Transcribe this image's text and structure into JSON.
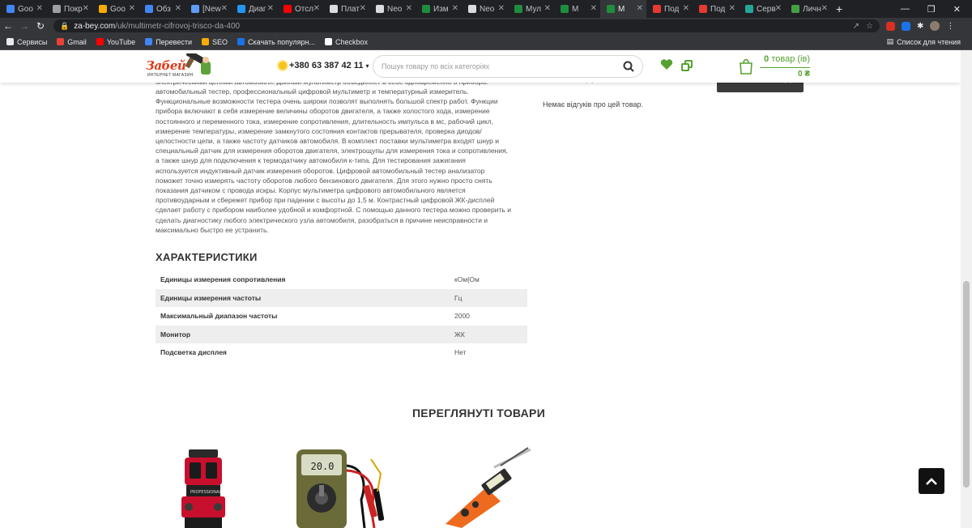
{
  "browser": {
    "tabs": [
      {
        "label": "Goo",
        "color": "#4285f4"
      },
      {
        "label": "Покр",
        "color": "#9aa0a6"
      },
      {
        "label": "Goo",
        "color": "#f9ab00"
      },
      {
        "label": "Обз",
        "color": "#4285f4"
      },
      {
        "label": "[New",
        "color": "#5f9cf5"
      },
      {
        "label": "Диаг",
        "color": "#2196f3"
      },
      {
        "label": "Отсл",
        "color": "#ff0000"
      },
      {
        "label": "Плат",
        "color": "#dadce0"
      },
      {
        "label": "Neo",
        "color": "#dadce0"
      },
      {
        "label": "Изм",
        "color": "#1e8e3e"
      },
      {
        "label": "Neo",
        "color": "#dadce0"
      },
      {
        "label": "Мул",
        "color": "#1e8e3e"
      },
      {
        "label": "М",
        "color": "#1e8e3e"
      },
      {
        "label": "М",
        "color": "#1e8e3e"
      },
      {
        "label": "Под",
        "color": "#e53935"
      },
      {
        "label": "Под",
        "color": "#e53935"
      },
      {
        "label": "Серв",
        "color": "#26a69a"
      },
      {
        "label": "Личн",
        "color": "#43a047"
      }
    ],
    "active_tab_index": 13,
    "new_tab": "+",
    "url_domain": "za-bey.com",
    "url_path": "/uk/multimetr-cifrovoj-trisco-da-400",
    "bookmarks": [
      {
        "label": "Сервисы",
        "color": "#e8eaed"
      },
      {
        "label": "Gmail",
        "color": "#ea4335"
      },
      {
        "label": "YouTube",
        "color": "#ff0000"
      },
      {
        "label": "Перевести",
        "color": "#4285f4"
      },
      {
        "label": "SEO",
        "color": "#f9ab00"
      },
      {
        "label": "Скачать популярн...",
        "color": "#1a73e8"
      },
      {
        "label": "Checkbox",
        "color": "#ffffff"
      }
    ],
    "reading_list": "Список для чтения"
  },
  "header": {
    "logo_text": "Забей",
    "logo_subtext": "ИНТЕРНЕТ МАГАЗИН",
    "phone": "+380 63 387 42 11",
    "search_placeholder": "Пошук товару по всіх категоріях",
    "cart_count": "0",
    "cart_count_suffix": " товар (ів)",
    "cart_sum": "0 ₴",
    "accent_color": "#56a231"
  },
  "description": {
    "lines": [
      "электрическими цепями автомобиля. Данный мультиметр объединяет в себе одновременно 3 прибора:",
      "автомобильный тестер, профессиональный цифровой мультиметр и температурный измеритель.",
      "Функциональные возможности тестера очень широки позволят выполнять большой спектр работ. Функции",
      "прибора включают в себя измерение величины оборотов двигателя, а также холостого хода, измерение",
      "постоянного и переменного тока, измерение сопротивления, длительность импульса в мс, рабочий цикл,",
      "измерение температуры, измерение замкнутого состояния контактов прерывателя, проверка диодов/",
      "целостности цепи, а также частоту датчиков автомобиля. В комплект поставки мультиметра входят шнур и",
      "специальный датчик для измерения оборотов двигателя, электрощупы для измерения тока и сопротивления,",
      "а также шнур для подключения к термодатчику автомобиля к-типа. Для тестирования зажигания",
      "используется индуктивный датчик измерения оборотов. Цифровой автомобильный тестер анализатор",
      "поможет точно измерять частоту оборотов любого бензинового двигателя. Для этого нужно просто снять",
      "показания датчиком с провода искры. Корпус мультиметра цифрового автомобильного является",
      "противоударным и сбережет прибор при падении с высоты до 1,5 м. Контрастный цифровой ЖК-дисплей",
      "сделает работу с прибором наиболее удобной и комфортной. С помощью данного тестера можно проверить и",
      "сделать диагностику любого электрического узла автомобиля, разобраться в причине неисправности и",
      "максимально быстро ее устранить."
    ]
  },
  "sidebar": {
    "no_reviews": "Немає відгуків про цей товар."
  },
  "characteristics": {
    "title": "ХАРАКТЕРИСТИКИ",
    "rows": [
      {
        "key": "Единицы измерения сопротивления",
        "value": "кОм|Ом"
      },
      {
        "key": "Единицы измерения частоты",
        "value": "Гц"
      },
      {
        "key": "Максимальный диапазон частоты",
        "value": "2000"
      },
      {
        "key": "Монитор",
        "value": "ЖК"
      },
      {
        "key": "Подсветка дисплея",
        "value": "Нет"
      }
    ]
  },
  "viewed": {
    "title": "ПЕРЕГЛЯНУТІ ТОВАРИ",
    "products": [
      {
        "name": "laser-level-image"
      },
      {
        "name": "multimeter-image",
        "display": "20.0"
      },
      {
        "name": "orange-tester-image"
      }
    ]
  }
}
